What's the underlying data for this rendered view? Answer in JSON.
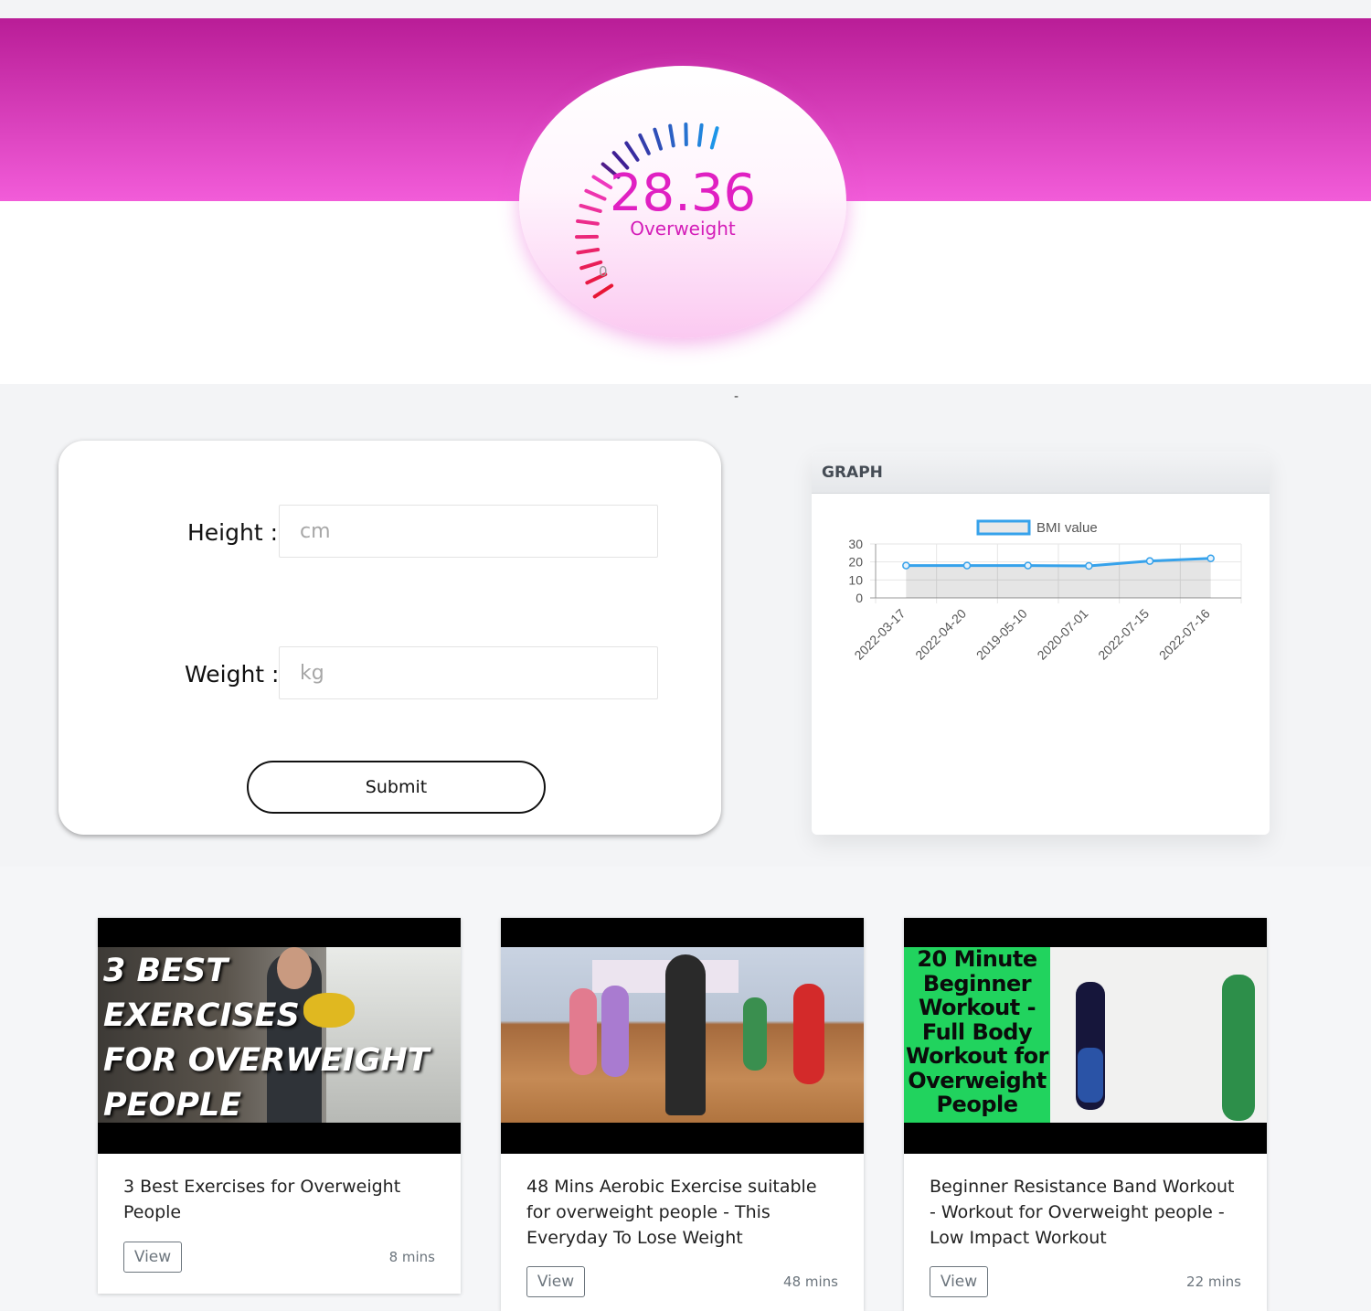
{
  "gauge": {
    "value": "28.36",
    "category": "Overweight",
    "min_label": "0"
  },
  "separator": "-",
  "form": {
    "height_label": "Height :",
    "height_placeholder": "cm",
    "weight_label": "Weight :",
    "weight_placeholder": "kg",
    "submit_label": "Submit"
  },
  "graph": {
    "header": "GRAPH"
  },
  "chart_data": {
    "type": "line",
    "title": "",
    "series": [
      {
        "name": "BMI value",
        "values": [
          18,
          18,
          18,
          17.8,
          20.5,
          22
        ]
      }
    ],
    "categories": [
      "2022-03-17",
      "2022-04-20",
      "2019-05-10",
      "2020-07-01",
      "2022-07-15",
      "2022-07-16"
    ],
    "y_ticks": [
      "30",
      "20",
      "10",
      "0"
    ],
    "ylim": [
      0,
      30
    ],
    "legend_position": "top-center",
    "fill": true,
    "grid": true,
    "colors": {
      "line": "#36a2eb",
      "fill": "#e6e6e6"
    }
  },
  "videos": [
    {
      "thumb_lines": [
        "3 BEST",
        "EXERCISES",
        "FOR OVERWEIGHT",
        "PEOPLE"
      ],
      "title": "3 Best Exercises for Overweight People",
      "view_label": "View",
      "duration": "8 mins"
    },
    {
      "title": "48 Mins Aerobic Exercise suitable for overweight people - This Everyday To Lose Weight",
      "view_label": "View",
      "duration": "48 mins"
    },
    {
      "thumb_lines": [
        "20 Minute",
        "Beginner",
        "Workout -",
        "Full Body",
        "Workout for",
        "Overweight",
        "People"
      ],
      "title": "Beginner Resistance Band Workout - Workout for Overweight people - Low Impact Workout",
      "view_label": "View",
      "duration": "22 mins"
    }
  ],
  "colors": {
    "hero_top": "#b91d97",
    "hero_bottom": "#f25cd9",
    "accent": "#e020c2"
  }
}
